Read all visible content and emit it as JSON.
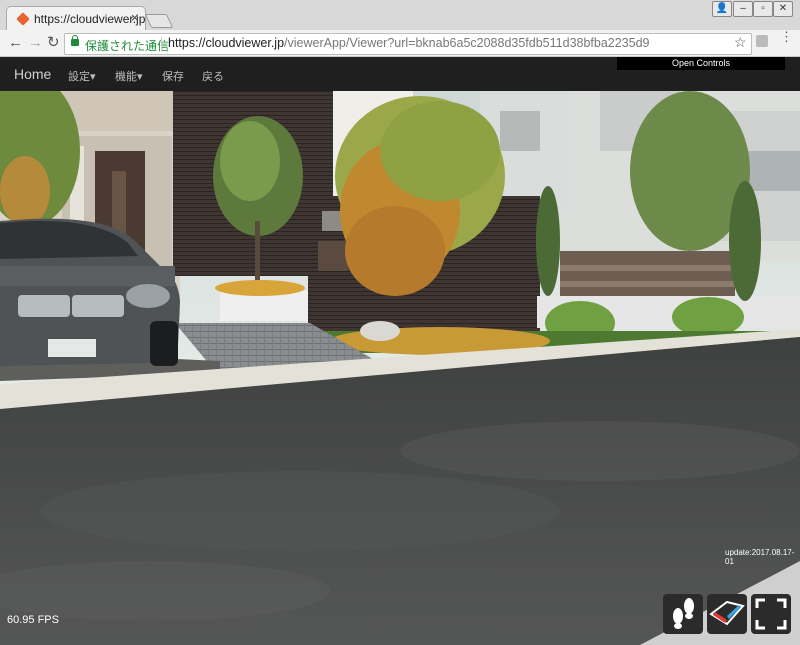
{
  "browser": {
    "tab_title": "https://cloudviewer.jp",
    "tab_close": "×",
    "security_label": "保護された通信",
    "url_host": "https://cloudviewer.jp",
    "url_path": "/viewerApp/Viewer?url=bknab6a5c2088d35fdb511d38bfba2235d9",
    "star": "☆"
  },
  "navbar": {
    "brand": "Home",
    "items": [
      {
        "label": "設定▾"
      },
      {
        "label": "機能▾"
      },
      {
        "label": "保存"
      },
      {
        "label": "戻る"
      }
    ],
    "open_controls": "Open Controls"
  },
  "viewer": {
    "fps": "60.95 FPS",
    "update": "update:2017.08.17-01"
  },
  "controls": {
    "walk_icon": "footsteps-icon",
    "vr_icon": "3d-glasses-icon",
    "fullscreen_icon": "fullscreen-icon"
  }
}
